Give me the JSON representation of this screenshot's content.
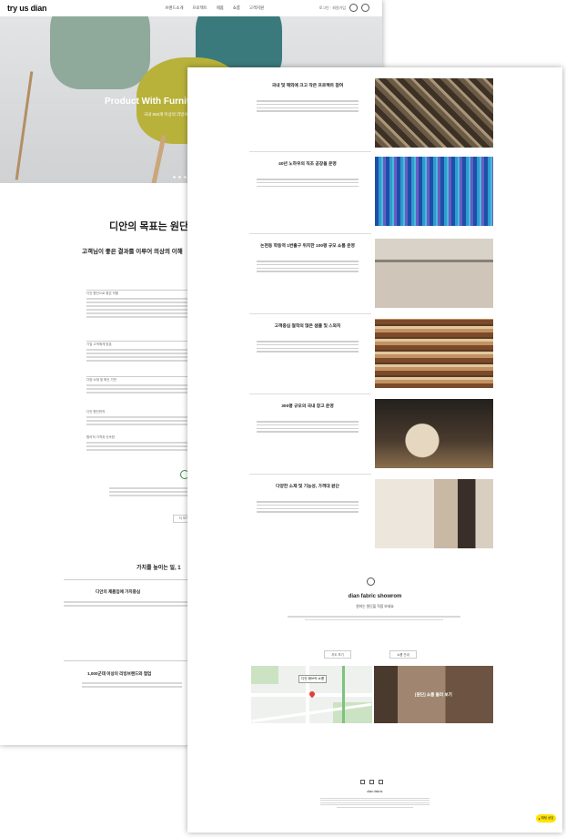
{
  "header": {
    "logo": "try us dian",
    "nav": [
      "브랜드소개",
      "프로젝트",
      "제품",
      "쇼룸",
      "고객지원"
    ],
    "right_text": "로그인 · 회원가입"
  },
  "hero": {
    "title": "Product With Furniture",
    "subtitle": "국내 800개 이상의 리빙브랜드"
  },
  "intro": {
    "heading": "디안의 목표는 원단",
    "subheading": "고객님이 좋은 결과를 이루어 의상의 이해",
    "labels": [
      "디안 원단으로 좋은 작품",
      "기업 고객에게 맞춘",
      "다양 소재 및 혁신 기반",
      "디안 원단만의",
      "합리적 가격과 신속한"
    ],
    "more_button": "더 보기",
    "values_heading": "가치를 높이는 일, 1",
    "feature1": "디안의 제품임에 가치중심",
    "feature2": "1,000군데 이상의 리빙브랜드와 협업"
  },
  "features": [
    {
      "title": "국내 및 해외에 크고 작은 프로젝트 참여"
    },
    {
      "title": "40년 노하우의 직조 공장을 운영"
    },
    {
      "title": "논현동 학동역 1번출구 위치한 100평 규모 쇼룸 운영"
    },
    {
      "title": "고객중심 철학의 많은 샘플 및 스와치"
    },
    {
      "title": "300평 규모의 국내 창고 운영"
    },
    {
      "title": "다양한 소재 및 기능성, 가격대 원단"
    }
  ],
  "showroom": {
    "title": "dian fabric showrom",
    "subtitle": "원하는 원단을 직접 보세요",
    "btn_map": "지도 보기",
    "btn_room": "쇼룸 안내",
    "map_label": "디안 패브릭 쇼룸",
    "room_label": "[원단] 쇼룸 둘러 보기"
  },
  "footer": {
    "company": "dian fabric",
    "kakao": "채팅 상담"
  }
}
